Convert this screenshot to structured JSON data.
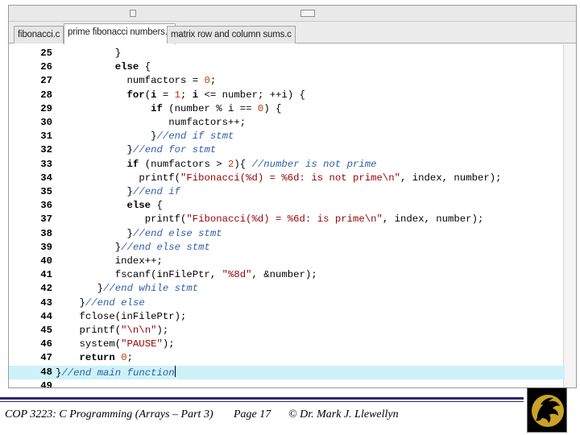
{
  "tabs": [
    {
      "label": "fibonacci.c",
      "active": false
    },
    {
      "label": "prime fibonacci numbers.c",
      "active": true
    },
    {
      "label": "matrix row and column sums.c",
      "active": false
    }
  ],
  "editor": {
    "highlighted_line": 48,
    "lines": [
      {
        "n": "25",
        "indent": 10,
        "tokens": [
          {
            "t": "}",
            "c": "txt"
          }
        ]
      },
      {
        "n": "26",
        "indent": 10,
        "tokens": [
          {
            "t": "else",
            "c": "kw"
          },
          {
            "t": " {",
            "c": "txt"
          }
        ]
      },
      {
        "n": "27",
        "indent": 12,
        "tokens": [
          {
            "t": "numfactors = ",
            "c": "txt"
          },
          {
            "t": "0",
            "c": "num"
          },
          {
            "t": ";",
            "c": "txt"
          }
        ]
      },
      {
        "n": "28",
        "indent": 12,
        "tokens": [
          {
            "t": "for",
            "c": "kw"
          },
          {
            "t": "(",
            "c": "txt"
          },
          {
            "t": "i",
            "c": "kw"
          },
          {
            "t": " = ",
            "c": "txt"
          },
          {
            "t": "1",
            "c": "num"
          },
          {
            "t": "; ",
            "c": "txt"
          },
          {
            "t": "i",
            "c": "kw"
          },
          {
            "t": " <= number; ++i) {",
            "c": "txt"
          }
        ]
      },
      {
        "n": "29",
        "indent": 16,
        "tokens": [
          {
            "t": "if",
            "c": "kw"
          },
          {
            "t": " (number % i == ",
            "c": "txt"
          },
          {
            "t": "0",
            "c": "num"
          },
          {
            "t": ") {",
            "c": "txt"
          }
        ]
      },
      {
        "n": "30",
        "indent": 19,
        "tokens": [
          {
            "t": "numfactors++;",
            "c": "txt"
          }
        ]
      },
      {
        "n": "31",
        "indent": 16,
        "tokens": [
          {
            "t": "}",
            "c": "txt"
          },
          {
            "t": "//end if stmt",
            "c": "cmt"
          }
        ]
      },
      {
        "n": "32",
        "indent": 12,
        "tokens": [
          {
            "t": "}",
            "c": "txt"
          },
          {
            "t": "//end for stmt",
            "c": "cmt"
          }
        ]
      },
      {
        "n": "33",
        "indent": 12,
        "tokens": [
          {
            "t": "if",
            "c": "kw"
          },
          {
            "t": " (numfactors > ",
            "c": "txt"
          },
          {
            "t": "2",
            "c": "num"
          },
          {
            "t": "){ ",
            "c": "txt"
          },
          {
            "t": "//number is not prime",
            "c": "cmt"
          }
        ]
      },
      {
        "n": "34",
        "indent": 14,
        "tokens": [
          {
            "t": "printf(",
            "c": "txt"
          },
          {
            "t": "\"Fibonacci(%d) = %6d: is not prime\\n\"",
            "c": "str"
          },
          {
            "t": ", index, number);",
            "c": "txt"
          }
        ]
      },
      {
        "n": "35",
        "indent": 12,
        "tokens": [
          {
            "t": "}",
            "c": "txt"
          },
          {
            "t": "//end if",
            "c": "cmt"
          }
        ]
      },
      {
        "n": "36",
        "indent": 12,
        "tokens": [
          {
            "t": "else",
            "c": "kw"
          },
          {
            "t": " {",
            "c": "txt"
          }
        ]
      },
      {
        "n": "37",
        "indent": 15,
        "tokens": [
          {
            "t": "printf(",
            "c": "txt"
          },
          {
            "t": "\"Fibonacci(%d) = %6d: is prime\\n\"",
            "c": "str"
          },
          {
            "t": ", index, number);",
            "c": "txt"
          }
        ]
      },
      {
        "n": "38",
        "indent": 12,
        "tokens": [
          {
            "t": "}",
            "c": "txt"
          },
          {
            "t": "//end else stmt",
            "c": "cmt"
          }
        ]
      },
      {
        "n": "39",
        "indent": 10,
        "tokens": [
          {
            "t": "}",
            "c": "txt"
          },
          {
            "t": "//end else stmt",
            "c": "cmt"
          }
        ]
      },
      {
        "n": "40",
        "indent": 10,
        "tokens": [
          {
            "t": "index++;",
            "c": "txt"
          }
        ]
      },
      {
        "n": "41",
        "indent": 10,
        "tokens": [
          {
            "t": "fscanf(inFilePtr, ",
            "c": "txt"
          },
          {
            "t": "\"%8d\"",
            "c": "str"
          },
          {
            "t": ", &number);",
            "c": "txt"
          }
        ]
      },
      {
        "n": "42",
        "indent": 7,
        "tokens": [
          {
            "t": "}",
            "c": "txt"
          },
          {
            "t": "//end while stmt",
            "c": "cmt"
          }
        ]
      },
      {
        "n": "43",
        "indent": 4,
        "tokens": [
          {
            "t": "}",
            "c": "txt"
          },
          {
            "t": "//end else",
            "c": "cmt"
          }
        ]
      },
      {
        "n": "44",
        "indent": 4,
        "tokens": [
          {
            "t": "fclose(inFilePtr);",
            "c": "txt"
          }
        ]
      },
      {
        "n": "45",
        "indent": 4,
        "tokens": [
          {
            "t": "printf(",
            "c": "txt"
          },
          {
            "t": "\"\\n\\n\"",
            "c": "str"
          },
          {
            "t": ");",
            "c": "txt"
          }
        ]
      },
      {
        "n": "46",
        "indent": 4,
        "tokens": [
          {
            "t": "system(",
            "c": "txt"
          },
          {
            "t": "\"PAUSE\"",
            "c": "str"
          },
          {
            "t": ");",
            "c": "txt"
          }
        ]
      },
      {
        "n": "47",
        "indent": 4,
        "tokens": [
          {
            "t": "return",
            "c": "kw"
          },
          {
            "t": " ",
            "c": "txt"
          },
          {
            "t": "0",
            "c": "num"
          },
          {
            "t": ";",
            "c": "txt"
          }
        ]
      },
      {
        "n": "48",
        "indent": 0,
        "tokens": [
          {
            "t": "}",
            "c": "txt"
          },
          {
            "t": "//end main function",
            "c": "cmt"
          }
        ]
      },
      {
        "n": "49",
        "indent": 0,
        "tokens": []
      }
    ]
  },
  "footer": {
    "course": "COP 3223: C Programming (Arrays – Part 3)",
    "page": "Page 17",
    "copyright": "© Dr. Mark J. Llewellyn"
  },
  "colors": {
    "footer_rule": "#2b2b6b",
    "highlight": "#ccf2f8",
    "comment": "#2f5ea8",
    "string": "#990000",
    "number": "#cc3300",
    "logo_gold": "#c9a227"
  },
  "icons": {
    "logo": "pegasus-logo"
  }
}
